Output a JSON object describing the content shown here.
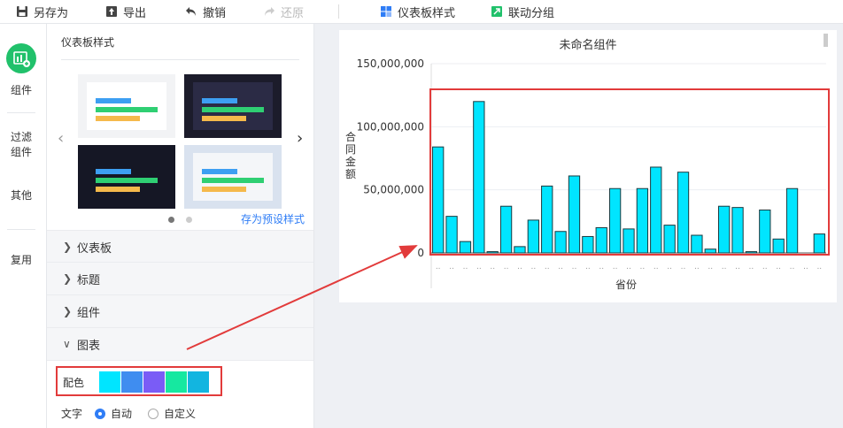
{
  "toolbar": {
    "save_as": "另存为",
    "export": "导出",
    "undo": "撤销",
    "redo": "还原",
    "dashboard_style": "仪表板样式",
    "linkage_group": "联动分组"
  },
  "rail": {
    "items": [
      "组件",
      "过滤组件",
      "其他",
      "复用"
    ]
  },
  "panel": {
    "title": "仪表板样式",
    "save_preset": "存为预设样式",
    "sections": [
      "仪表板",
      "标题",
      "组件",
      "图表"
    ],
    "color_label": "配色",
    "palette": [
      "#00e5ff",
      "#3f8df0",
      "#7a5cf6",
      "#16e8a0",
      "#12b5e0"
    ],
    "text_label": "文字",
    "text_auto": "自动",
    "text_custom": "自定义",
    "text_selected": "自动"
  },
  "chart": {
    "title": "未命名组件",
    "xlabel": "省份",
    "ylabel": "合同金额"
  },
  "chart_data": {
    "type": "bar",
    "title": "未命名组件",
    "xlabel": "省份",
    "ylabel": "合同金额",
    "ylim": [
      0,
      150000000
    ],
    "y_ticks": [
      "150,000,000",
      "100,000,000",
      "50,000,000",
      "0"
    ],
    "bar_color": "#00e5ff",
    "values": [
      84000000,
      29000000,
      9000000,
      120000000,
      1000000,
      37000000,
      5000000,
      26000000,
      53000000,
      17000000,
      61000000,
      13000000,
      20000000,
      51000000,
      19000000,
      51000000,
      68000000,
      22000000,
      64000000,
      14000000,
      3000000,
      37000000,
      36000000,
      1000000,
      34000000,
      11000000,
      51000000,
      0,
      15000000
    ]
  }
}
